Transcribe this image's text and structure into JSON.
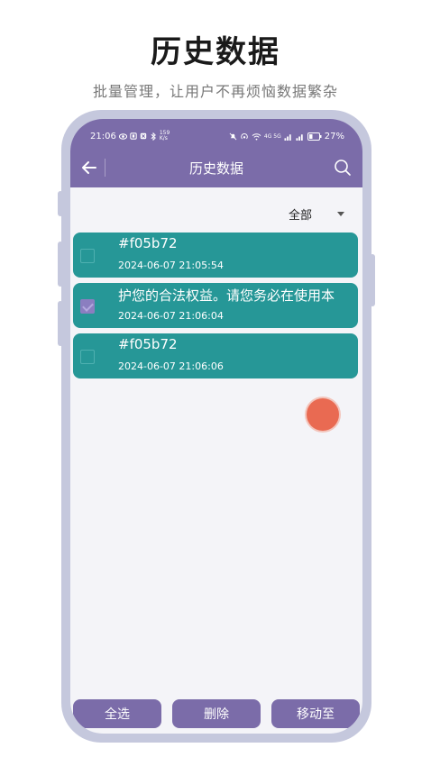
{
  "promo": {
    "title": "历史数据",
    "subtitle": "批量管理，让用户不再烦恼数据繁杂"
  },
  "status_bar": {
    "time": "21:06",
    "speed_value": "159",
    "speed_unit": "K/s",
    "network": "4G 5G",
    "battery": "27%"
  },
  "app_bar": {
    "title": "历史数据",
    "back_icon": "arrow-left-icon",
    "search_icon": "search-icon"
  },
  "filter": {
    "selected": "全部"
  },
  "items": [
    {
      "title": "#f05b72",
      "time": "2024-06-07 21:05:54",
      "checked": false
    },
    {
      "title": "护您的合法权益。请您务必在使用本",
      "time": "2024-06-07 21:06:04",
      "checked": true
    },
    {
      "title": "#f05b72",
      "time": "2024-06-07 21:06:06",
      "checked": false
    }
  ],
  "actions": {
    "select_all": "全选",
    "delete": "删除",
    "move_to": "移动至"
  },
  "colors": {
    "accent": "#7b6ca9",
    "item_bg": "#269797",
    "fab": "#e96a52"
  }
}
